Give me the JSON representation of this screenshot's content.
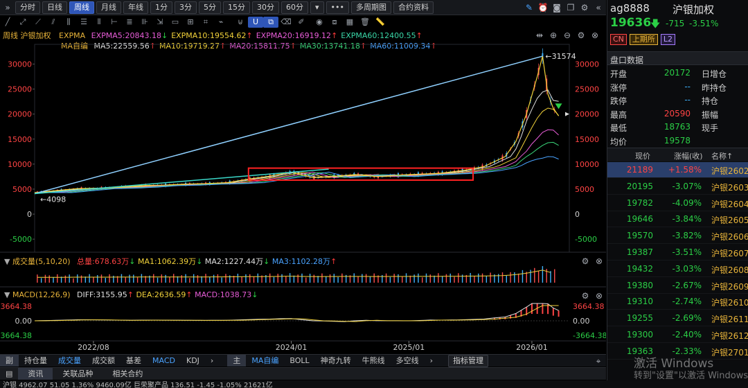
{
  "toolbar": {
    "expand": "»",
    "tabs": [
      "分时",
      "日线",
      "周线",
      "月线",
      "年线",
      "1分",
      "3分",
      "5分",
      "15分",
      "30分",
      "60分"
    ],
    "active_tab": "周线",
    "more": "•••",
    "multi_period": "多周期图",
    "contract_info": "合约资料"
  },
  "legend": {
    "period": "周线",
    "name": "沪银加权",
    "expma_label": "EXPMA",
    "expma": [
      {
        "label": "EXPMA5:20843.18",
        "dir": "down",
        "color": "#e85dd8"
      },
      {
        "label": "EXPMA10:19554.62",
        "dir": "up",
        "color": "#f2d23a"
      },
      {
        "label": "EXPMA20:16919.12",
        "dir": "up",
        "color": "#e85dd8"
      },
      {
        "label": "EXPMA60:12400.55",
        "dir": "up",
        "color": "#3ad7a8"
      }
    ],
    "ma_label": "MA自编",
    "ma": [
      {
        "label": "MA5:22559.56",
        "dir": "up",
        "color": "#e0e0e0"
      },
      {
        "label": "MA10:19719.27",
        "dir": "up",
        "color": "#f2d23a"
      },
      {
        "label": "MA20:15811.75",
        "dir": "up",
        "color": "#e85dd8"
      },
      {
        "label": "MA30:13741.18",
        "dir": "up",
        "color": "#3ad77a"
      },
      {
        "label": "MA60:11009.34",
        "dir": "up",
        "color": "#4aa3ff"
      }
    ]
  },
  "chart_data": {
    "type": "line",
    "y_ticks": [
      "30000",
      "25000",
      "20000",
      "15000",
      "10000",
      "5000",
      "0",
      "-5000"
    ],
    "ylim": [
      -6500,
      32000
    ],
    "x_ticks": [
      "2022/08",
      "2024/01",
      "2025/01",
      "2026/01"
    ],
    "high_label": "31574",
    "low_label": "4098",
    "high": 31574,
    "low": 4098,
    "price_series": [
      [
        0,
        4300
      ],
      [
        8,
        4700
      ],
      [
        16,
        5100
      ],
      [
        24,
        5200
      ],
      [
        32,
        5400
      ],
      [
        40,
        5700
      ],
      [
        48,
        5800
      ],
      [
        56,
        6000
      ],
      [
        64,
        6100
      ],
      [
        72,
        6300
      ],
      [
        80,
        7000
      ],
      [
        88,
        7600
      ],
      [
        96,
        8400
      ],
      [
        104,
        7300
      ],
      [
        112,
        7600
      ],
      [
        120,
        7900
      ],
      [
        128,
        7500
      ],
      [
        136,
        7800
      ],
      [
        144,
        8000
      ],
      [
        152,
        8200
      ],
      [
        160,
        8700
      ],
      [
        168,
        9500
      ],
      [
        176,
        11500
      ],
      [
        180,
        14500
      ],
      [
        184,
        20000
      ],
      [
        188,
        27500
      ],
      [
        190,
        31574
      ],
      [
        192,
        24000
      ],
      [
        194,
        21189
      ],
      [
        196,
        19636
      ]
    ],
    "ma_series_end": [
      22559.56,
      19719.27,
      15811.75,
      13741.18,
      11009.34
    ],
    "x_range": [
      0,
      200
    ]
  },
  "volume_panel": {
    "title": "成交量(5,10,20)",
    "total": "总量:678.63万",
    "ma1": "MA1:1062.39万",
    "ma2": "MA2:1227.44万",
    "ma3": "MA3:1102.28万"
  },
  "macd_panel": {
    "title": "MACD(12,26,9)",
    "diff": "DIFF:3155.95",
    "dea": "DEA:2636.59",
    "macd": "MACD:1038.73",
    "top": "3664.38",
    "mid": "0.00",
    "bottom": "-3664.38"
  },
  "bottom_tabs_left": [
    "副",
    "持仓量",
    "成交量",
    "成交额",
    "基差",
    "MACD",
    "KDJ"
  ],
  "bottom_tabs_left_active": [
    "成交量",
    "MACD"
  ],
  "bottom_tabs_right": [
    "主",
    "MA自编",
    "BOLL",
    "神奇九转",
    "牛熊线",
    "多空线"
  ],
  "bottom_tabs_right_active": "MA自编",
  "indicator_manage": "指标管理",
  "info_tabs": [
    "资讯",
    "关联品种",
    "相关合约"
  ],
  "ticker": "沪银  4962.07  51.05  1.36%  9460.09亿      巨荣聚产品    136.51  -1.45  -1.05%  21621亿",
  "right_panel": {
    "code": "ag8888",
    "name": "沪银加权",
    "price": "19636",
    "change": "-715",
    "change_pct": "-3.51%",
    "badges": [
      "CN",
      "上期所",
      "L2"
    ],
    "section_title": "盘口数据",
    "quote_rows": [
      {
        "k1": "开盘",
        "v1": "20172",
        "k2": "日增仓"
      },
      {
        "k1": "涨停",
        "v1": "--",
        "k2": "昨持仓"
      },
      {
        "k1": "跌停",
        "v1": "--",
        "k2": "持仓"
      },
      {
        "k1": "最高",
        "v1": "20590",
        "k2": "振幅"
      },
      {
        "k1": "最低",
        "v1": "18763",
        "k2": "现手"
      },
      {
        "k1": "均价",
        "v1": "19578",
        "k2": ""
      }
    ],
    "contract_header": [
      "现价",
      "涨幅(收)",
      "名称↑"
    ],
    "contracts": [
      {
        "price": "21189",
        "pct": "+1.58%",
        "name": "沪银2602"
      },
      {
        "price": "20195",
        "pct": "-3.07%",
        "name": "沪银2603"
      },
      {
        "price": "19782",
        "pct": "-4.09%",
        "name": "沪银2604"
      },
      {
        "price": "19646",
        "pct": "-3.84%",
        "name": "沪银2605"
      },
      {
        "price": "19570",
        "pct": "-3.82%",
        "name": "沪银2606"
      },
      {
        "price": "19387",
        "pct": "-3.51%",
        "name": "沪银2607"
      },
      {
        "price": "19432",
        "pct": "-3.03%",
        "name": "沪银2608"
      },
      {
        "price": "19380",
        "pct": "-2.67%",
        "name": "沪银2609"
      },
      {
        "price": "19310",
        "pct": "-2.74%",
        "name": "沪银2610"
      },
      {
        "price": "19255",
        "pct": "-2.69%",
        "name": "沪银2611"
      },
      {
        "price": "19300",
        "pct": "-2.40%",
        "name": "沪银2612"
      },
      {
        "price": "19363",
        "pct": "-2.33%",
        "name": "沪银2701"
      }
    ],
    "watermark1": "激活 Windows",
    "watermark2": "转到\"设置\"以激活 Windows。"
  }
}
